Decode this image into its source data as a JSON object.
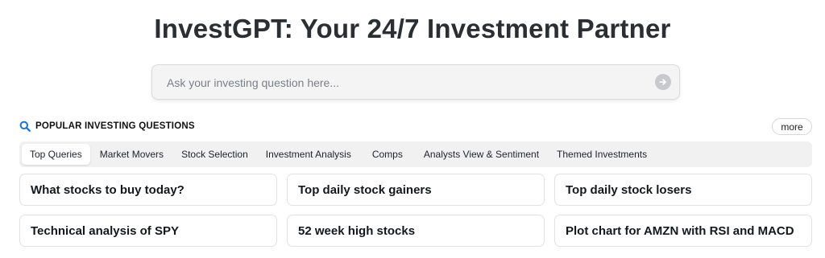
{
  "header": {
    "title": "InvestGPT: Your 24/7 Investment Partner"
  },
  "search": {
    "placeholder": "Ask your investing question here...",
    "value": "",
    "submit_icon": "arrow-right-circle-icon"
  },
  "popular": {
    "icon": "search-icon",
    "title": "POPULAR INVESTING QUESTIONS",
    "more_label": "more"
  },
  "tabs": [
    {
      "label": "Top Queries",
      "active": true
    },
    {
      "label": "Market Movers",
      "active": false
    },
    {
      "label": "Stock Selection",
      "active": false
    },
    {
      "label": "Investment Analysis",
      "active": false
    },
    {
      "label": "Comps",
      "active": false
    },
    {
      "label": "Analysts View & Sentiment",
      "active": false
    },
    {
      "label": "Themed Investments",
      "active": false
    }
  ],
  "questions": [
    "What stocks to buy today?",
    "Top daily stock gainers",
    "Top daily stock losers",
    "Technical analysis of SPY",
    "52 week high stocks",
    "Plot chart for AMZN with RSI and MACD"
  ],
  "colors": {
    "accent": "#1d6fd8",
    "submit_button": "#c7c9cc"
  }
}
